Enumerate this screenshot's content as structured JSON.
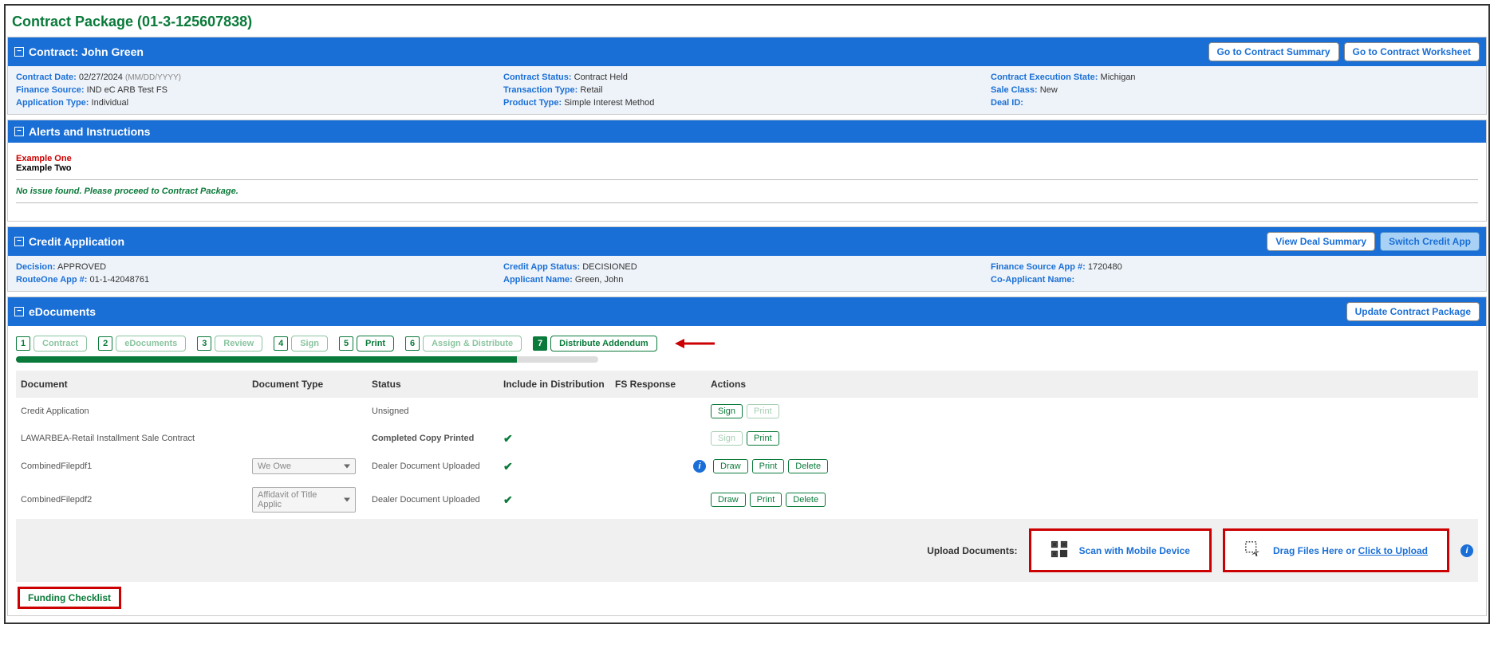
{
  "page": {
    "title": "Contract Package (01-3-125607838)"
  },
  "contract_header": {
    "title": "Contract:   John Green",
    "btn_summary": "Go to Contract Summary",
    "btn_worksheet": "Go to Contract Worksheet"
  },
  "contract_info": {
    "col1": {
      "date_label": "Contract Date:",
      "date_value": "02/27/2024",
      "date_format": "(MM/DD/YYYY)",
      "finance_label": "Finance Source:",
      "finance_value": "IND eC ARB Test FS",
      "app_type_label": "Application Type:",
      "app_type_value": "Individual"
    },
    "col2": {
      "status_label": "Contract Status:",
      "status_value": "Contract Held",
      "trans_label": "Transaction Type:",
      "trans_value": "Retail",
      "product_label": "Product Type:",
      "product_value": "Simple Interest Method"
    },
    "col3": {
      "exec_label": "Contract Execution State:",
      "exec_value": "Michigan",
      "sale_label": "Sale Class:",
      "sale_value": "New",
      "deal_label": "Deal ID:",
      "deal_value": ""
    }
  },
  "alerts": {
    "title": "Alerts and Instructions",
    "line1": "Example One",
    "line2": "Example Two",
    "status": "No issue found. Please proceed to Contract Package."
  },
  "credit_app": {
    "title": "Credit Application",
    "btn_deal": "View Deal Summary",
    "btn_switch": "Switch Credit App",
    "col1": {
      "decision_label": "Decision:",
      "decision_value": "APPROVED",
      "route_label": "RouteOne App #:",
      "route_value": "01-1-42048761"
    },
    "col2": {
      "status_label": "Credit App Status:",
      "status_value": "DECISIONED",
      "name_label": "Applicant Name:",
      "name_value": "Green, John"
    },
    "col3": {
      "fs_label": "Finance Source App #:",
      "fs_value": "1720480",
      "co_label": "Co-Applicant Name:",
      "co_value": ""
    }
  },
  "edocs": {
    "title": "eDocuments",
    "btn_update": "Update Contract Package",
    "steps": {
      "s1": "Contract",
      "s2": "eDocuments",
      "s3": "Review",
      "s4": "Sign",
      "s5": "Print",
      "s6": "Assign & Distribute",
      "s7": "Distribute Addendum",
      "n1": "1",
      "n2": "2",
      "n3": "3",
      "n4": "4",
      "n5": "5",
      "n6": "6",
      "n7": "7"
    },
    "table": {
      "h_doc": "Document",
      "h_type": "Document Type",
      "h_status": "Status",
      "h_include": "Include in Distribution",
      "h_fs": "FS Response",
      "h_actions": "Actions",
      "rows": [
        {
          "doc": "Credit Application",
          "type": "",
          "status": "Unsigned",
          "check": false,
          "actions": {
            "sign": true,
            "sign_disabled": false,
            "print": true,
            "print_disabled": true,
            "draw": false,
            "delete": false,
            "info": false
          }
        },
        {
          "doc": "LAWARBEA-Retail Installment Sale Contract",
          "type": "",
          "status": "Completed Copy Printed",
          "check": true,
          "actions": {
            "sign": true,
            "sign_disabled": true,
            "print": true,
            "print_disabled": false,
            "draw": false,
            "delete": false,
            "info": false
          }
        },
        {
          "doc": "CombinedFilepdf1",
          "type": "We Owe",
          "type_select": true,
          "status": "Dealer Document Uploaded",
          "check": true,
          "actions": {
            "sign": false,
            "print": true,
            "draw": true,
            "delete": true,
            "info": true
          }
        },
        {
          "doc": "CombinedFilepdf2",
          "type": "Affidavit of Title Applic",
          "type_select": true,
          "status": "Dealer Document Uploaded",
          "check": true,
          "actions": {
            "sign": false,
            "print": true,
            "draw": true,
            "delete": true,
            "info": false
          }
        }
      ],
      "btn_sign": "Sign",
      "btn_print": "Print",
      "btn_draw": "Draw",
      "btn_delete": "Delete"
    },
    "upload": {
      "label": "Upload Documents:",
      "scan": "Scan with Mobile Device",
      "drag_prefix": "Drag Files Here or ",
      "drag_link": "Click to Upload"
    },
    "funding": "Funding Checklist"
  }
}
